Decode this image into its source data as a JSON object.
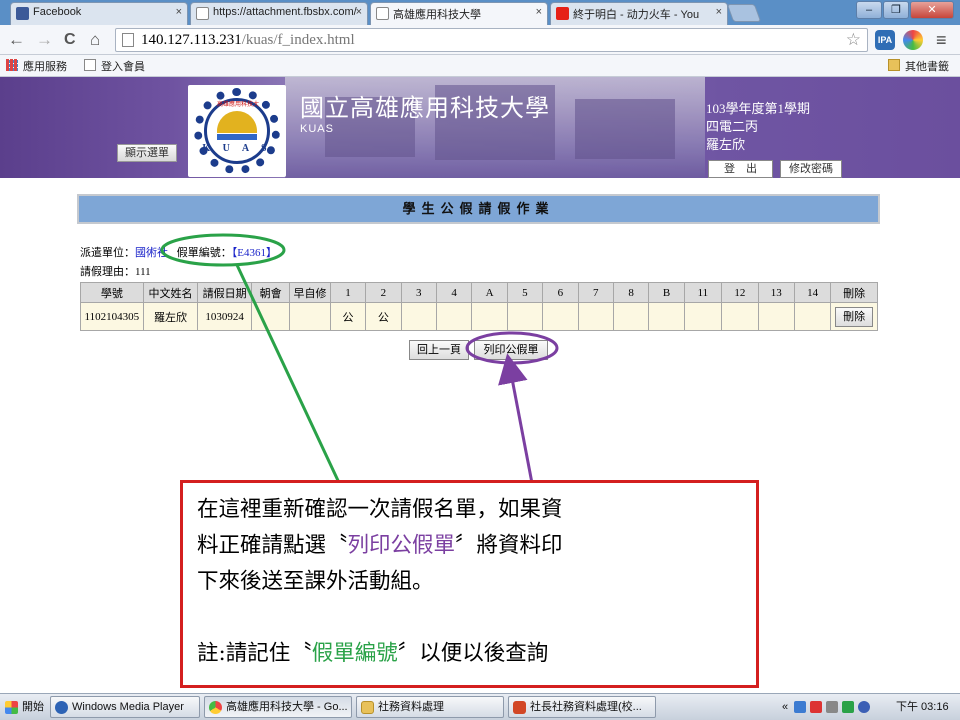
{
  "browser": {
    "tabs": [
      {
        "label": "Facebook",
        "icon": "facebook-icon",
        "color": "#3b5998"
      },
      {
        "label": "https://attachment.fbsbx.com/",
        "icon": "page-icon",
        "color": "#aaaaaa"
      },
      {
        "label": "高雄應用科技大學",
        "icon": "page-icon",
        "color": "#aaaaaa"
      },
      {
        "label": "終于明白 - 动力火车 - You",
        "icon": "youtube-icon",
        "color": "#e62117"
      }
    ],
    "tab_close": "×",
    "nav": {
      "back": "←",
      "forward": "→",
      "reload": "C",
      "home": "⌂"
    },
    "url_host": "140.127.113.231",
    "url_path": "/kuas/f_index.html",
    "star": "☆",
    "ext_ipa_label": "IPA",
    "menu_icon": "≡",
    "window": {
      "minimize": "‒",
      "restore": "❐",
      "close": "✕"
    },
    "bookmarks": [
      {
        "label": "應用服務",
        "icon": "apps-grid-icon"
      },
      {
        "label": "登入會員",
        "icon": "page-icon"
      }
    ],
    "other_bookmarks": "其他書籤"
  },
  "header": {
    "logo_letters": "K U A S",
    "logo_text": "高雄應用科技大",
    "menu_button": "顯示選單",
    "school_name": "國立高雄應用科技大學",
    "school_en": "KUAS",
    "term": "103學年度第1學期",
    "class_name": "四電二丙",
    "student_name": "羅左欣",
    "logout": "登　出",
    "change_password": "修改密碼"
  },
  "main": {
    "title": "學生公假請假作業",
    "unit_label": "派遣單位：",
    "unit_value": "國術社",
    "form_no_label": "假單編號：",
    "form_no_value": "【E4361】",
    "reason_label": "請假理由：",
    "reason_value": "111",
    "table_headers": [
      "學號",
      "中文姓名",
      "請假日期",
      "朝會",
      "早自修",
      "1",
      "2",
      "3",
      "4",
      "A",
      "5",
      "6",
      "7",
      "8",
      "B",
      "11",
      "12",
      "13",
      "14",
      "刪除"
    ],
    "row": {
      "student_id": "1102104305",
      "name": "羅左欣",
      "date": "1030924",
      "morning": "",
      "self_study": "",
      "p1": "公",
      "p2": "公",
      "p3": "",
      "p4": "",
      "pA": "",
      "p5": "",
      "p6": "",
      "p7": "",
      "p8": "",
      "pB": "",
      "p11": "",
      "p12": "",
      "p13": "",
      "p14": "",
      "delete": "刪除"
    },
    "back_button": "回上一頁",
    "print_button": "列印公假單"
  },
  "note": {
    "line1": "在這裡重新確認一次請假名單，如果資",
    "line2_pre": "料正確請點選〝",
    "line2_highlight": "列印公假單",
    "line2_post": "〞將資料印",
    "line3": "下來後送至課外活動組。",
    "line4_pre": "註:請記住〝",
    "line4_highlight": "假單編號",
    "line4_post": "〞以便以後查詢",
    "colors": {
      "border": "#d41f1f",
      "purple": "#7b3fa1",
      "green": "#2aa248"
    }
  },
  "taskbar": {
    "start": "開始",
    "tasks": [
      {
        "label": "Windows Media Player",
        "icon": "media-player-icon"
      },
      {
        "label": "高雄應用科技大學 - Go...",
        "icon": "chrome-icon"
      },
      {
        "label": "社務資料處理",
        "icon": "folder-icon"
      },
      {
        "label": "社長社務資料處理(校...",
        "icon": "powerpoint-icon"
      }
    ],
    "tray_prefix": "«",
    "clock": "下午 03:16"
  }
}
